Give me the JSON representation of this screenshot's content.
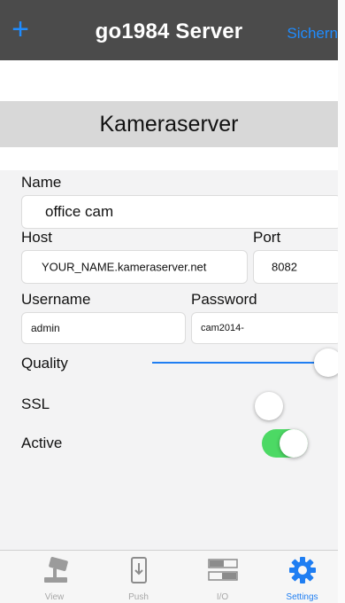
{
  "nav": {
    "add_icon": "plus-icon",
    "title": "go1984 Server",
    "save_label": "Sichern"
  },
  "section": {
    "title": "Kameraserver"
  },
  "form": {
    "name_label": "Name",
    "name_value": "office cam",
    "host_label": "Host",
    "host_value": "YOUR_NAME.kameraserver.net",
    "port_label": "Port",
    "port_value": "8082",
    "username_label": "Username",
    "username_value": "admin",
    "password_label": "Password",
    "password_value": "cam2014-",
    "quality_label": "Quality",
    "quality_level": 1.0,
    "ssl_label": "SSL",
    "ssl_on": false,
    "active_label": "Active",
    "active_on": true
  },
  "tabs": [
    {
      "label": "View",
      "icon": "camera-icon",
      "active": false
    },
    {
      "label": "Push",
      "icon": "phone-icon",
      "active": false
    },
    {
      "label": "I/O",
      "icon": "io-switch-icon",
      "active": false
    },
    {
      "label": "Settings",
      "icon": "gear-icon",
      "active": true
    }
  ],
  "colors": {
    "accent": "#1f7ef2",
    "toggle_on": "#4cd964",
    "navbar": "#4b4b4b"
  }
}
